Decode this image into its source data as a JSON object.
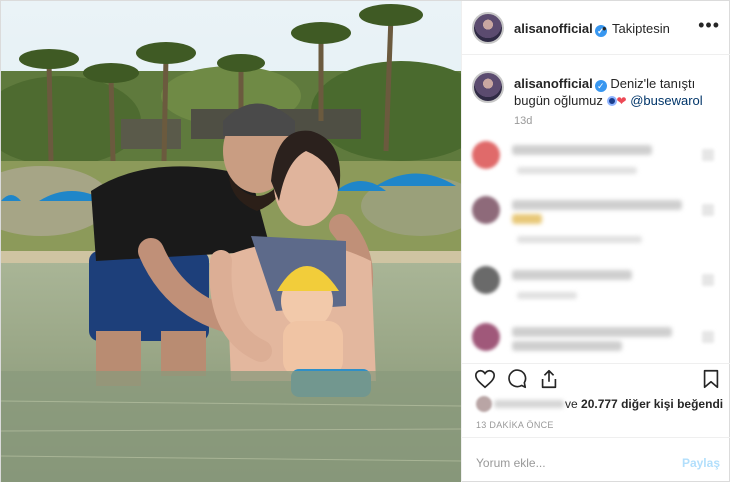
{
  "header": {
    "username": "alisanofficial",
    "separator": "•",
    "follow_status": "Takiptesin",
    "more": "•••"
  },
  "caption": {
    "username": "alisanofficial",
    "text": "Deniz'le tanıştı bugün oğlumuz",
    "mention": "@busewarol",
    "time": "13d"
  },
  "likes": {
    "prefix": "ve",
    "count": "20.777",
    "suffix": "diğer kişi beğendi"
  },
  "time_ago": "13 DAKİKA ÖNCE",
  "comment_box": {
    "placeholder": "Yorum ekle...",
    "post_label": "Paylaş"
  },
  "icons": [
    "verified-badge-icon",
    "more-options-icon",
    "heart-icon",
    "comment-icon",
    "share-icon",
    "bookmark-icon",
    "nazar-bead-icon",
    "red-heart-icon"
  ],
  "colors": {
    "verified": "#3897f0",
    "link": "#003569",
    "heart": "#ed4956",
    "post_disabled": "#b2dffc"
  }
}
